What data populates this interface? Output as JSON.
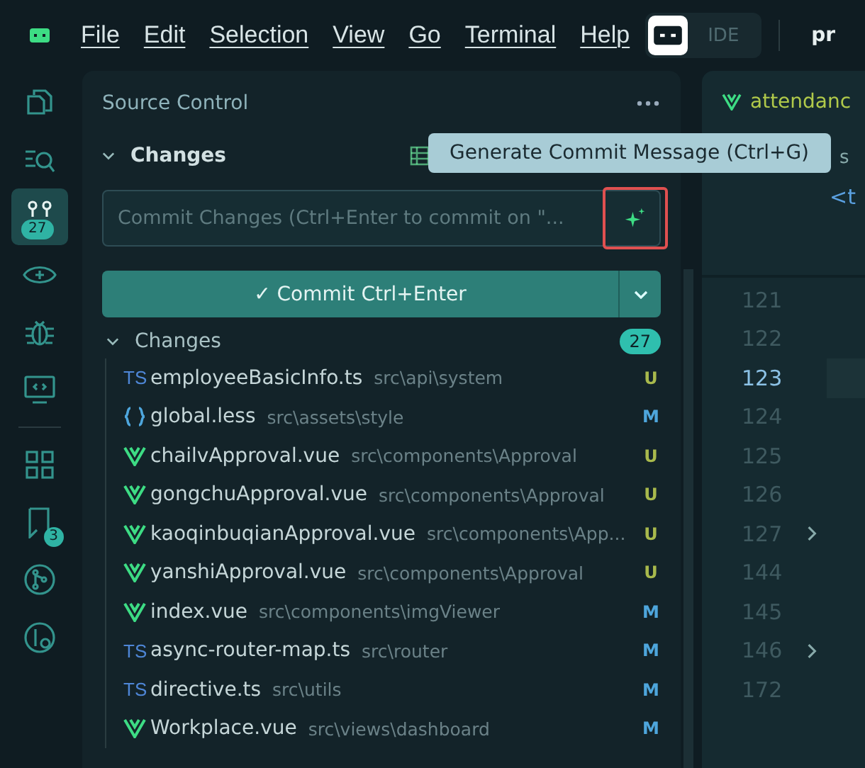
{
  "menu": [
    "File",
    "Edit",
    "Selection",
    "View",
    "Go",
    "Terminal",
    "Help"
  ],
  "mode_toggle": {
    "label": "IDE",
    "ide_selected": false
  },
  "top_right_text": "pr",
  "activity_bar": [
    {
      "kind": "files",
      "selected": false
    },
    {
      "kind": "search",
      "selected": false
    },
    {
      "kind": "source-control",
      "selected": true,
      "badge": "27"
    },
    {
      "kind": "eye",
      "selected": false
    },
    {
      "kind": "bug",
      "selected": false
    },
    {
      "kind": "remote",
      "selected": false
    },
    {
      "kind": "separator"
    },
    {
      "kind": "grid",
      "selected": false
    },
    {
      "kind": "bookmark",
      "selected": false,
      "badge": "3"
    },
    {
      "kind": "graph",
      "selected": false
    },
    {
      "kind": "graph-search",
      "selected": false
    }
  ],
  "panel": {
    "title": "Source Control",
    "section": "Changes",
    "expanded": true,
    "commit_placeholder": "Commit Changes (Ctrl+Enter to commit on \"...",
    "tooltip": "Generate Commit Message (Ctrl+G)",
    "generate_highlighted": true,
    "commit_button": "✓ Commit Ctrl+Enter",
    "changes_group": {
      "label": "Changes",
      "count": "27",
      "expanded": true
    },
    "files": [
      {
        "kind": "ts",
        "icon_text": "TS",
        "name": "employeeBasicInfo.ts",
        "path": "src\\api\\system",
        "status": "U",
        "color": "#a8b94c"
      },
      {
        "kind": "less",
        "name": "global.less",
        "path": "src\\assets\\style",
        "status": "M",
        "color": "#4ea6dc"
      },
      {
        "kind": "vue",
        "name": "chailvApproval.vue",
        "path": "src\\components\\Approval",
        "status": "U",
        "color": "#a8b94c"
      },
      {
        "kind": "vue",
        "name": "gongchuApproval.vue",
        "path": "src\\components\\Approval",
        "status": "U",
        "color": "#a8b94c"
      },
      {
        "kind": "vue",
        "name": "kaoqinbuqianApproval.vue",
        "path": "src\\components\\App...",
        "status": "U",
        "color": "#a8b94c"
      },
      {
        "kind": "vue",
        "name": "yanshiApproval.vue",
        "path": "src\\components\\Approval",
        "status": "U",
        "color": "#a8b94c"
      },
      {
        "kind": "vue",
        "name": "index.vue",
        "path": "src\\components\\imgViewer",
        "status": "M",
        "color": "#4ea6dc"
      },
      {
        "kind": "ts",
        "icon_text": "TS",
        "name": "async-router-map.ts",
        "path": "src\\router",
        "status": "M",
        "color": "#4ea6dc"
      },
      {
        "kind": "ts",
        "icon_text": "TS",
        "name": "directive.ts",
        "path": "src\\utils",
        "status": "M",
        "color": "#4ea6dc"
      },
      {
        "kind": "vue",
        "name": "Workplace.vue",
        "path": "src\\views\\dashboard",
        "status": "M",
        "color": "#4ea6dc"
      }
    ]
  },
  "editor": {
    "tab": "attendanc",
    "breadcrumb": "s",
    "code": "<t",
    "lines": [
      {
        "number": "121",
        "current": false,
        "fold": false
      },
      {
        "number": "122",
        "current": false,
        "fold": false
      },
      {
        "number": "123",
        "current": true,
        "fold": false
      },
      {
        "number": "124",
        "current": false,
        "fold": false
      },
      {
        "number": "125",
        "current": false,
        "fold": false
      },
      {
        "number": "126",
        "current": false,
        "fold": false
      },
      {
        "number": "127",
        "current": false,
        "fold": true
      },
      {
        "number": "144",
        "current": false,
        "fold": false
      },
      {
        "number": "145",
        "current": false,
        "fold": false
      },
      {
        "number": "146",
        "current": false,
        "fold": true
      },
      {
        "number": "172",
        "current": false,
        "fold": false
      }
    ]
  }
}
